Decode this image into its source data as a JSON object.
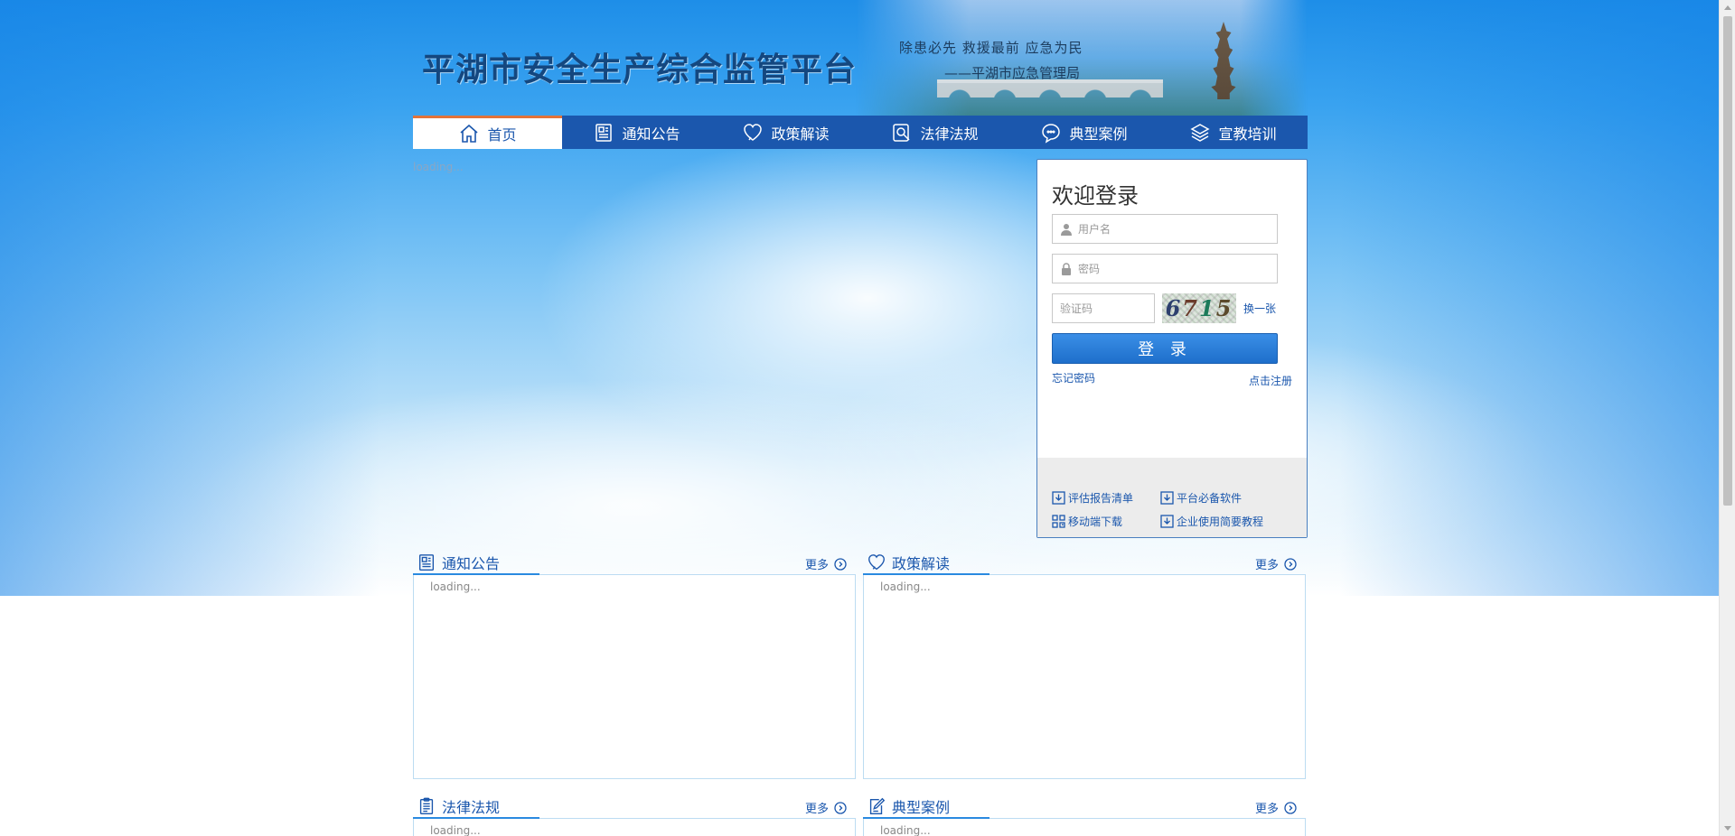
{
  "header": {
    "site_title": "平湖市安全生产综合监管平台",
    "motto": "除患必先  救援最前  应急为民",
    "motto_sub": "——平湖市应急管理局"
  },
  "nav": {
    "items": [
      {
        "label": "首页",
        "icon": "home-icon"
      },
      {
        "label": "通知公告",
        "icon": "notice-icon"
      },
      {
        "label": "政策解读",
        "icon": "heart-icon"
      },
      {
        "label": "法律法规",
        "icon": "search-icon"
      },
      {
        "label": "典型案例",
        "icon": "chat-icon"
      },
      {
        "label": "宣教培训",
        "icon": "layers-icon"
      }
    ],
    "active_index": 0
  },
  "banner": {
    "loading_text": "loading..."
  },
  "login": {
    "title": "欢迎登录",
    "username_placeholder": "用户名",
    "password_placeholder": "密码",
    "captcha_placeholder": "验证码",
    "captcha_digits": [
      "6",
      "7",
      "1",
      "5"
    ],
    "refresh_label": "换一张",
    "login_button": "登 录",
    "forgot_label": "忘记密码",
    "register_label": "点击注册",
    "downloads": [
      {
        "label": "评估报告清单",
        "icon": "download-icon"
      },
      {
        "label": "平台必备软件",
        "icon": "download-icon"
      },
      {
        "label": "移动端下载",
        "icon": "qrcode-icon"
      },
      {
        "label": "企业使用简要教程",
        "icon": "download-icon"
      }
    ]
  },
  "sections": [
    {
      "title": "通知公告",
      "more": "更多",
      "loading": "loading...",
      "icon": "notice-icon"
    },
    {
      "title": "政策解读",
      "more": "更多",
      "loading": "loading...",
      "icon": "heart-icon"
    },
    {
      "title": "法律法规",
      "more": "更多",
      "loading": "loading...",
      "icon": "clipboard-icon"
    },
    {
      "title": "典型案例",
      "more": "更多",
      "loading": "loading...",
      "icon": "edit-icon"
    }
  ],
  "colors": {
    "nav_bg": "#1b57ad",
    "active_border": "#e2733a",
    "accent": "#2a8ae0"
  }
}
